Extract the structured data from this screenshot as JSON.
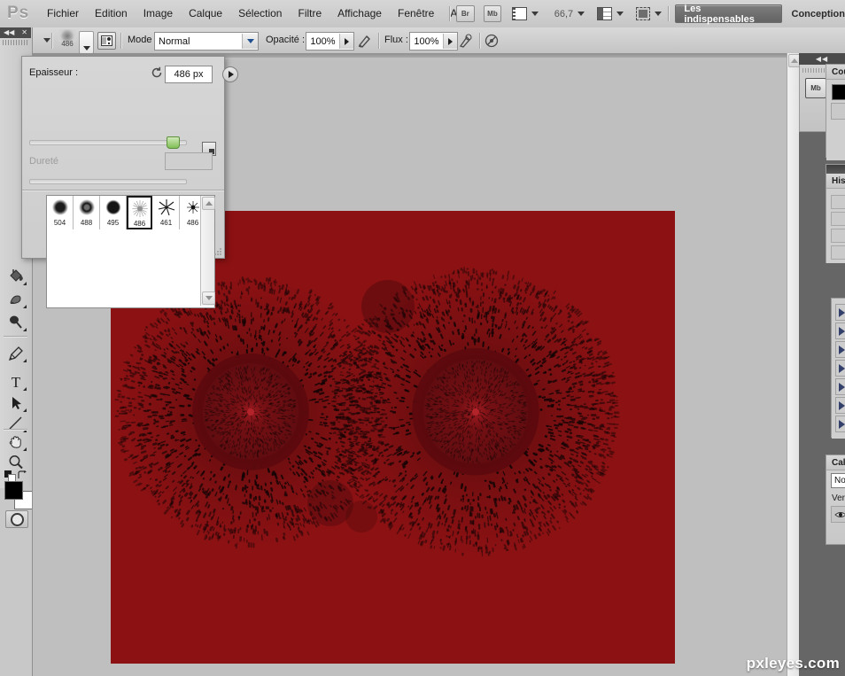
{
  "app": {
    "logo": "Ps",
    "menus": [
      "Fichier",
      "Edition",
      "Image",
      "Calque",
      "Sélection",
      "Filtre",
      "Affichage",
      "Fenêtre",
      "Aide"
    ],
    "bridge_label": "Br",
    "minibridge_label": "Mb",
    "zoom_level": "66,7",
    "workspace_active": "Les indispensables",
    "workspace_next": "Conception",
    "watermark": "pxleyes.com"
  },
  "options_bar": {
    "brush_size_preview": "486",
    "mode_label": "Mode :",
    "mode_value": "Normal",
    "opacity_label": "Opacité :",
    "opacity_value": "100%",
    "flux_label": "Flux :",
    "flux_value": "100%"
  },
  "toolbox": {
    "tools": [
      {
        "name": "paint-bucket-tool"
      },
      {
        "name": "dodge-tool"
      },
      {
        "name": "blur-tool"
      },
      {
        "name": "pen-tool"
      },
      {
        "name": "type-tool"
      },
      {
        "name": "path-selection-tool"
      },
      {
        "name": "line-tool"
      },
      {
        "name": "hand-tool"
      },
      {
        "name": "zoom-tool"
      }
    ],
    "foreground_color": "#000000",
    "background_color": "#ffffff"
  },
  "brush_panel": {
    "thickness_label": "Epaisseur :",
    "thickness_value": "486 px",
    "thickness_slider_pct": 82,
    "hardness_label": "Dureté",
    "hardness_value": "",
    "hardness_slider_pct": 0,
    "presets": [
      {
        "label": "504",
        "kind": "soft-round",
        "selected": false
      },
      {
        "label": "488",
        "kind": "ring-round",
        "selected": false
      },
      {
        "label": "495",
        "kind": "hard-round",
        "selected": false
      },
      {
        "label": "486",
        "kind": "starburst",
        "selected": true
      },
      {
        "label": "461",
        "kind": "scatter-splat",
        "selected": false
      },
      {
        "label": "486",
        "kind": "small-star",
        "selected": false
      }
    ]
  },
  "right_dock": {
    "minibridge_badge": "Mb",
    "panels": [
      {
        "name": "channels-panel",
        "title": "Cou"
      },
      {
        "name": "history-panel",
        "title": "Hist"
      },
      {
        "name": "layers-panel",
        "title": "Cal",
        "blend_mode": "Nor",
        "lock_label": "Ver"
      }
    ]
  },
  "document": {
    "canvas_background": "#8b1113",
    "art_ink_color": "#120405"
  }
}
